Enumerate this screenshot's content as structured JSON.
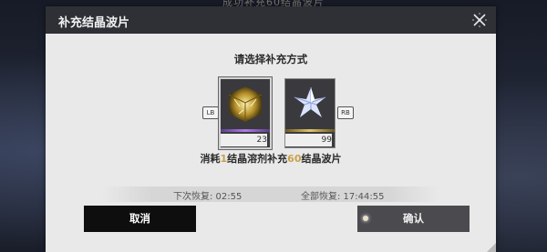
{
  "background": {
    "banner_text": "成功补充60结晶波片"
  },
  "dialog": {
    "title": "补充结晶波片",
    "subtitle": "请选择补充方式",
    "items": [
      {
        "name": "结晶溶剂",
        "count": "23",
        "hint": "LB",
        "icon": "crystal-solvent-icon"
      },
      {
        "name": "结晶",
        "count": "99",
        "hint": "RB",
        "icon": "crystal-icon"
      }
    ],
    "consume": {
      "prefix": "消耗",
      "amount": "1",
      "middle": "结晶溶剂补充",
      "gain": "60",
      "suffix": "结晶波片"
    },
    "recovery": {
      "next": "下次恢复: 02:55",
      "full": "全部恢复: 17:44:55"
    },
    "buttons": {
      "cancel": "取消",
      "confirm": "确认"
    }
  },
  "colors": {
    "accent_gold": "#c8a24a",
    "selected_bar": "#9b6fd1",
    "header_bg": "#2e3036"
  }
}
